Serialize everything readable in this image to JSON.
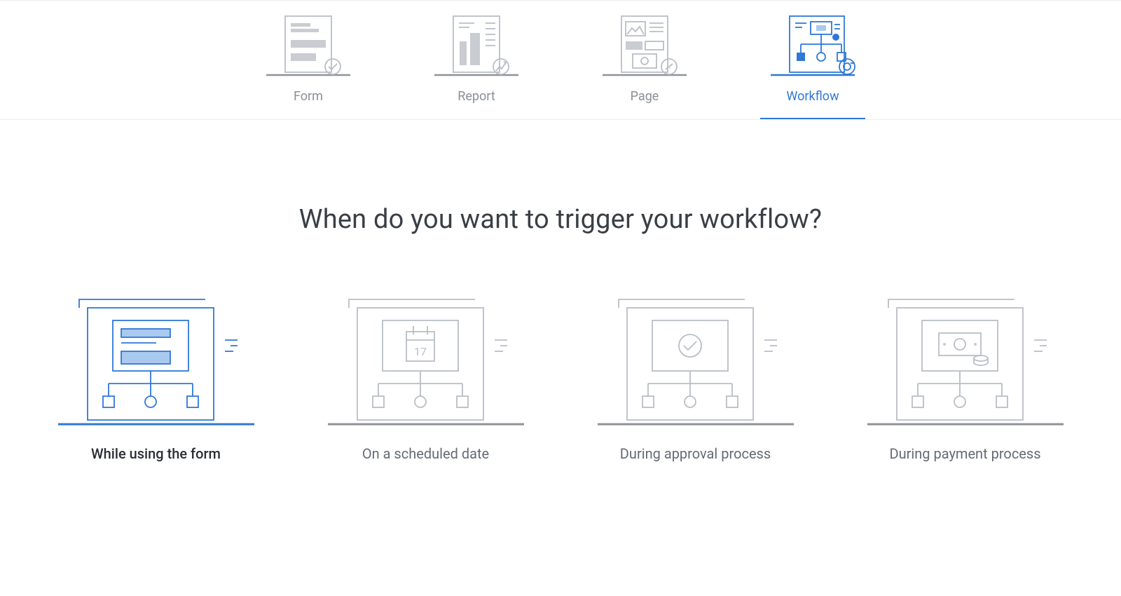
{
  "tabs": {
    "form": {
      "label": "Form"
    },
    "report": {
      "label": "Report"
    },
    "page": {
      "label": "Page"
    },
    "workflow": {
      "label": "Workflow"
    }
  },
  "active_tab": "workflow",
  "heading": "When do you want to trigger your workflow?",
  "trigger_options": {
    "form": {
      "label": "While using the form"
    },
    "schedule": {
      "label": "On a scheduled date",
      "day": "17"
    },
    "approval": {
      "label": "During approval process"
    },
    "payment": {
      "label": "During payment process"
    }
  },
  "selected_option": "form"
}
